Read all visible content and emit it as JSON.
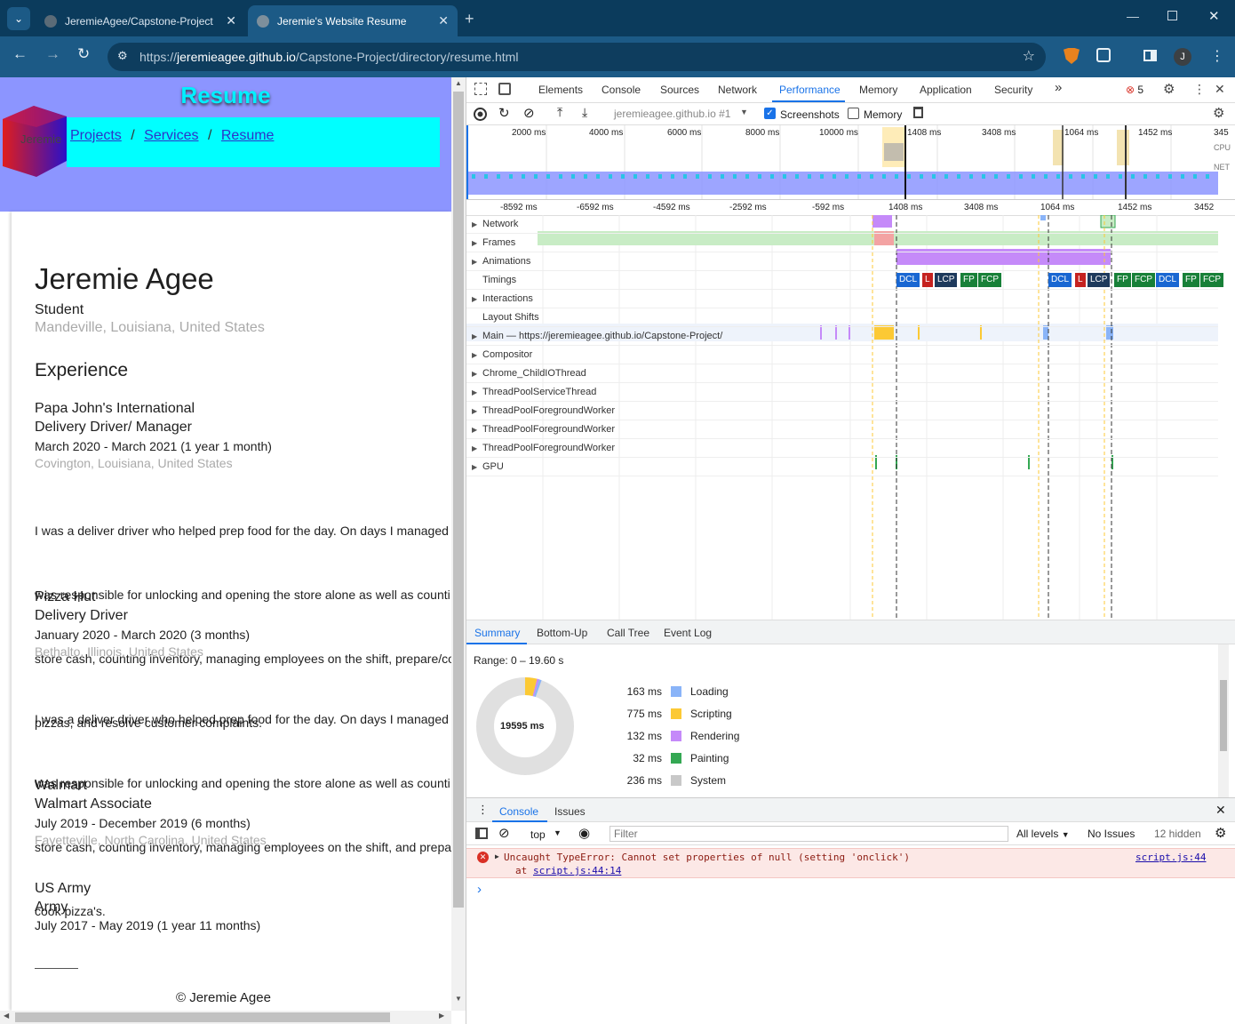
{
  "browser": {
    "tabs": [
      {
        "title": "JeremieAgee/Capstone-Project"
      },
      {
        "title": "Jeremie's Website Resume"
      }
    ],
    "url_prefix": "https://",
    "url_host": "jeremieagee.github.io",
    "url_path": "/Capstone-Project/directory/resume.html",
    "profile_initial": "J"
  },
  "page": {
    "title": "Resume",
    "cube_text": "Jeremie",
    "nav": [
      "Projects",
      "/",
      "Services",
      "/",
      "Resume"
    ],
    "name": "Jeremie Agee",
    "headline": "Student",
    "location": "Mandeville, Louisiana, United States",
    "section": "Experience",
    "jobs": [
      {
        "company": "Papa John's International",
        "role": "Delivery Driver/ Manager",
        "dates": "March 2020 - March 2021 (1 year 1 month)",
        "place": "Covington, Louisiana, United States",
        "lines": [
          "I was a deliver driver who helped prep food for the day. On days I managed",
          "was responsible for unlocking and opening the store alone as well as counti",
          "store cash, counting inventory, managing employees on the shift, prepare/co",
          "pizzas, and resolve customer complaints."
        ]
      },
      {
        "company": "Pizza Hut",
        "role": "Delivery Driver",
        "dates": "January 2020 - March 2020 (3 months)",
        "place": "Bethalto, Illinois, United States",
        "lines": [
          "I was a deliver driver who helped prep food for the day. On days I managed",
          "was responsible for unlocking and opening the store alone as well as counti",
          "store cash, counting inventory, managing employees on the shift, and prepa",
          "cook pizza's."
        ]
      },
      {
        "company": "Walmart",
        "role": "Walmart Associate",
        "dates": "July 2019 - December 2019 (6 months)",
        "place": "Fayetteville, North Carolina, United States",
        "lines": []
      },
      {
        "company": "US Army",
        "role": "Army",
        "dates": "July 2017 - May 2019 (1 year 11 months)",
        "place": "",
        "lines": []
      }
    ],
    "footer": "© Jeremie Agee"
  },
  "devtools": {
    "tabs": [
      "Elements",
      "Console",
      "Sources",
      "Network",
      "Performance",
      "Memory",
      "Application",
      "Security"
    ],
    "selected_tab": "Performance",
    "error_count": "5",
    "recording_select": "jeremieagee.github.io #1",
    "screenshots_label": "Screenshots",
    "memory_label": "Memory",
    "overview_ticks": [
      "2000 ms",
      "4000 ms",
      "6000 ms",
      "8000 ms",
      "10000 ms",
      "1408 ms",
      "3408 ms",
      "1064 ms",
      "1452 ms",
      "345"
    ],
    "overview_side": [
      "CPU",
      "NET"
    ],
    "ruler_ticks": [
      "-8592 ms",
      "-6592 ms",
      "-4592 ms",
      "-2592 ms",
      "-592 ms",
      "1408 ms",
      "3408 ms",
      "1064 ms",
      "1452 ms",
      "3452"
    ],
    "tracks": [
      "Network",
      "Frames",
      "Animations",
      "Timings",
      "Interactions",
      "Layout Shifts",
      "Main — https://jeremieagee.github.io/Capstone-Project/",
      "Compositor",
      "Chrome_ChildIOThread",
      "ThreadPoolServiceThread",
      "ThreadPoolForegroundWorker",
      "ThreadPoolForegroundWorker",
      "ThreadPoolForegroundWorker",
      "GPU"
    ],
    "timing_markers_a": [
      "DCL",
      "L",
      "LCP",
      "FP",
      "FCP"
    ],
    "timing_markers_b": [
      "DCL",
      "L",
      "LCP",
      "FP",
      "FCP",
      "DCL",
      "FP",
      "FCP"
    ],
    "bottom_tabs": [
      "Summary",
      "Bottom-Up",
      "Call Tree",
      "Event Log"
    ],
    "range": "Range: 0 – 19.60 s",
    "total": "19595 ms",
    "summary": [
      {
        "value": "163 ms",
        "label": "Loading",
        "color": "#8ab4f8"
      },
      {
        "value": "775 ms",
        "label": "Scripting",
        "color": "#fcc934"
      },
      {
        "value": "132 ms",
        "label": "Rendering",
        "color": "#c58af9"
      },
      {
        "value": "32 ms",
        "label": "Painting",
        "color": "#34a853"
      },
      {
        "value": "236 ms",
        "label": "System",
        "color": "#c8c8c8"
      }
    ],
    "drawer_tabs": [
      "Console",
      "Issues"
    ],
    "console_context": "top",
    "filter_placeholder": "Filter",
    "levels": "All levels",
    "issues": "No Issues",
    "hidden": "12 hidden",
    "error_message": "Uncaught TypeError: Cannot set properties of null (setting 'onclick')",
    "error_at": "at",
    "error_link": "script.js:44:14",
    "error_source": "script.js:44",
    "prompt": "›"
  }
}
